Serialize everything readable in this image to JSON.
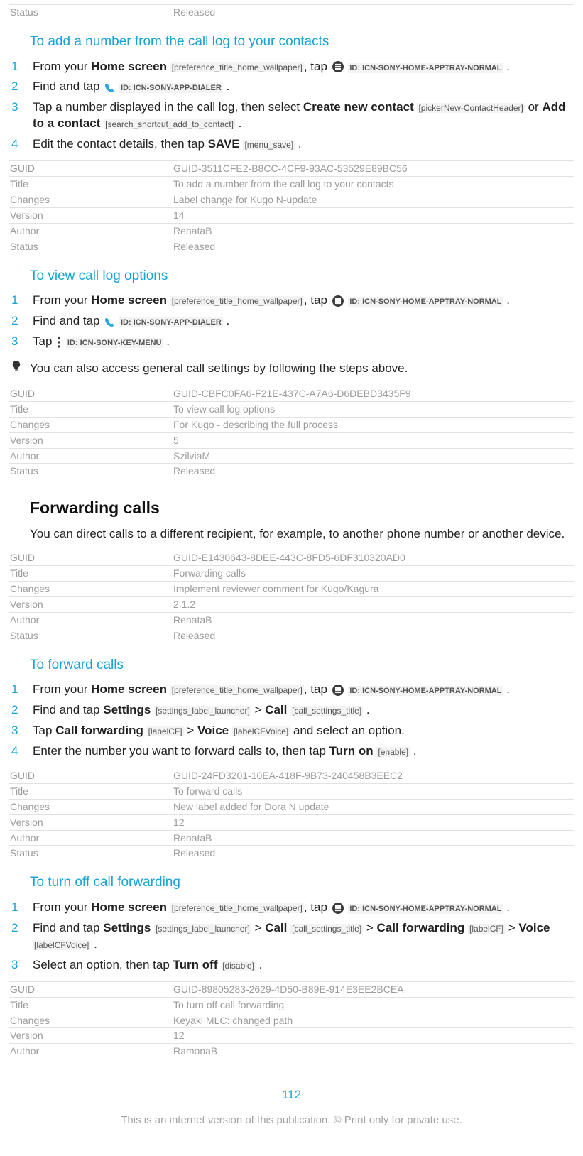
{
  "labels": {
    "GUID": "GUID",
    "Title": "Title",
    "Changes": "Changes",
    "Version": "Version",
    "Author": "Author",
    "Status": "Status"
  },
  "fragments": {
    "from_your": "From your ",
    "home_screen": "Home screen",
    "home_tag": "[preference_title_home_wallpaper]",
    "tap": ", tap ",
    "apptray_id": "ID: ICN-SONY-HOME-APPTRAY-NORMAL",
    "dot": " .",
    "find_and_tap": "Find and tap ",
    "dialer_id": "ID: ICN-SONY-APP-DIALER",
    "settings": "Settings",
    "settings_tag": "[settings_label_launcher]",
    "call": "Call",
    "call_tag": "[call_settings_title]",
    "cf": "Call forwarding",
    "cf_tag": "[labelCF]",
    "voice": "Voice",
    "voice_tag": "[labelCFVoice]",
    "gt": " > ",
    "tap_word": "Tap ",
    "menu_id": "ID: ICN-SONY-KEY-MENU",
    "save": "SAVE",
    "save_tag": "[menu_save]",
    "turn_on": "Turn on",
    "enable_tag": "[enable]",
    "turn_off": "Turn off",
    "disable_tag": "[disable]",
    "create_new": "Create new contact",
    "create_tag": "[pickerNew-ContactHeader]",
    "add_to": "Add to a contact",
    "add_tag": "[search_shortcut_add_to_contact]",
    "or": " or ",
    "and_select": " and select an option.",
    "period": " ."
  },
  "topMeta": {
    "Status": "Released"
  },
  "procedures": [
    {
      "title": "To add a number from the call log to your contacts",
      "meta": {
        "GUID": "GUID-3511CFE2-B8CC-4CF9-93AC-53529E89BC56",
        "Title": "To add a number from the call log to your contacts",
        "Changes": "Label change for Kugo N-update",
        "Version": "14",
        "Author": "RenataB",
        "Status": "Released"
      }
    },
    {
      "title": "To view call log options",
      "tip": "You can also access general call settings by following the steps above.",
      "meta": {
        "GUID": "GUID-CBFC0FA6-F21E-437C-A7A6-D6DEBD3435F9",
        "Title": "To view call log options",
        "Changes": "For Kugo - describing the full process",
        "Version": "5",
        "Author": "SzilviaM",
        "Status": "Released"
      }
    }
  ],
  "section": {
    "title": "Forwarding calls",
    "body": "You can direct calls to a different recipient, for example, to another phone number or another device.",
    "meta": {
      "GUID": "GUID-E1430643-8DEE-443C-8FD5-6DF310320AD0",
      "Title": "Forwarding calls",
      "Changes": "Implement reviewer comment for Kugo/Kagura",
      "Version": "2.1.2",
      "Author": "RenataB",
      "Status": "Released"
    }
  },
  "proc_fwd": {
    "title": "To forward calls",
    "step3b": "Enter the number you want to forward calls to, then tap ",
    "meta": {
      "GUID": "GUID-24FD3201-10EA-418F-9B73-240458B3EEC2",
      "Title": "To forward calls",
      "Changes": "New label added for Dora N update",
      "Version": "12",
      "Author": "RenataB",
      "Status": "Released"
    }
  },
  "proc_off": {
    "title": "To turn off call forwarding",
    "step3a": "Select an option, then tap ",
    "meta": {
      "GUID": "GUID-89805283-2629-4D50-B89E-914E3EE2BCEA",
      "Title": "To turn off call forwarding",
      "Changes": "Keyaki MLC: changed path",
      "Version": "12",
      "Author": "RamonaB"
    }
  },
  "step_texts": {
    "p1_s3": "Tap a number displayed in the call log, then select ",
    "p1_s4": "Edit the contact details, then tap "
  },
  "pageNumber": "112",
  "footer": "This is an internet version of this publication. © Print only for private use.",
  "nums": [
    "1",
    "2",
    "3",
    "4"
  ]
}
